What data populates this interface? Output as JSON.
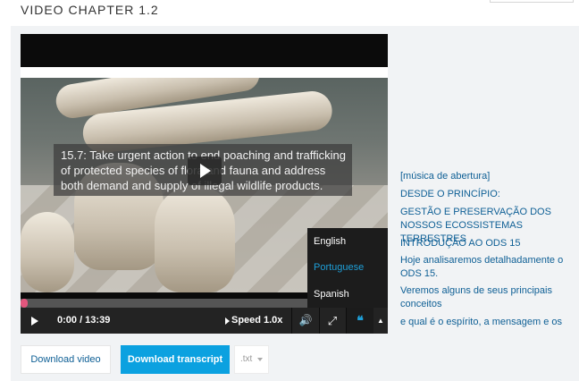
{
  "chapter": {
    "title": "VIDEO CHAPTER 1.2"
  },
  "video": {
    "caption": "15.7: Take urgent action to end poaching and trafficking of protected species of flora and fauna and address both demand and supply of illegal wildlife products."
  },
  "controls": {
    "time": "0:00 / 13:39",
    "speed_label": "Speed",
    "speed_value": "1.0x",
    "progress_percent": 0,
    "icons": {
      "play": "play-icon",
      "volume": "volume-icon",
      "fullscreen": "fullscreen-icon",
      "captions": "captions-icon",
      "language_toggle": "chevron-up-icon"
    },
    "cc_symbol": "❝",
    "volume_symbol": "🔊",
    "fullscreen_symbol": "✕",
    "toggle_symbol": "▲"
  },
  "languages": [
    {
      "label": "English",
      "active": false
    },
    {
      "label": "Portuguese",
      "active": true
    },
    {
      "label": "Spanish",
      "active": false
    }
  ],
  "transcript": [
    "[música de abertura]",
    "DESDE O PRINCÍPIO:",
    "GESTÃO E PRESERVAÇÃO DOS NOSSOS ECOSSISTEMAS TERRESTRES",
    "INTRODUÇÃO AO ODS 15",
    "Hoje analisaremos detalhadamente o ODS 15.",
    "Veremos alguns de seus principais conceitos",
    "e qual é o espírito, a mensagem e os"
  ],
  "downloads": {
    "video_label": "Download video",
    "transcript_label": "Download transcript",
    "format_value": ".txt"
  },
  "colors": {
    "accent": "#0ba1e0",
    "link": "#0e5f95",
    "progress_knob": "#e2567d",
    "active_language": "#1e9fd8"
  }
}
